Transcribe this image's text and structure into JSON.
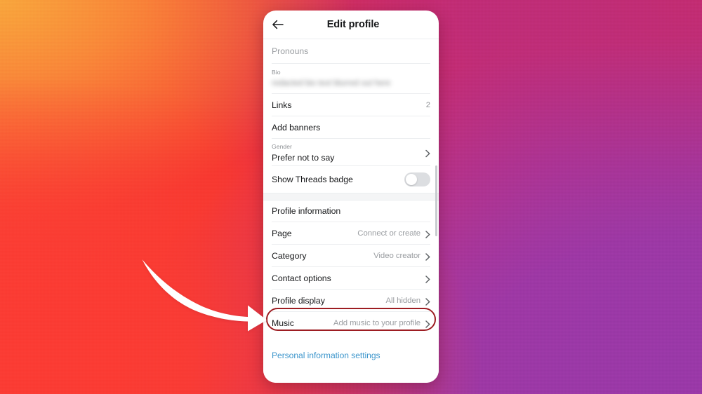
{
  "background": {
    "name": "instagram-gradient",
    "colors": {
      "orange": "#f9a63c",
      "red": "#fb3b33",
      "crimson": "#d92a5e",
      "magenta": "#b9358f",
      "purple": "#9d3aa6"
    }
  },
  "annotation": {
    "arrow_name": "curved-arrow-pointing-to-music",
    "arrow_color": "#ffffff",
    "highlight_color": "#9d1d22",
    "highlight_target": "Music"
  },
  "phone": {
    "header": {
      "back_icon": "back-arrow-icon",
      "title": "Edit profile"
    },
    "rows": [
      {
        "id": "pronouns",
        "label": "Pronouns",
        "is_placeholder": true,
        "value": "",
        "chevron": false
      },
      {
        "id": "bio",
        "caption": "Bio",
        "value": "redacted bio text blurred out here",
        "blurred": true
      },
      {
        "id": "links",
        "label": "Links",
        "count": "2",
        "chevron": false
      },
      {
        "id": "add-banners",
        "label": "Add banners",
        "value": "",
        "chevron": false
      },
      {
        "id": "gender",
        "caption": "Gender",
        "value": "Prefer not to say",
        "chevron": true
      },
      {
        "id": "show-threads-badge",
        "label": "Show Threads badge",
        "toggle": "off"
      },
      {
        "id": "profile-information",
        "label": "Profile information",
        "value": "",
        "chevron": false
      },
      {
        "id": "page",
        "label": "Page",
        "value": "Connect or create",
        "chevron": true
      },
      {
        "id": "category",
        "label": "Category",
        "value": "Video creator",
        "chevron": true
      },
      {
        "id": "contact-options",
        "label": "Contact options",
        "value": "",
        "chevron": true
      },
      {
        "id": "profile-display",
        "label": "Profile display",
        "value": "All hidden",
        "chevron": true
      },
      {
        "id": "music",
        "label": "Music",
        "value": "Add music to your profile",
        "chevron": true,
        "highlighted": true
      }
    ],
    "link": {
      "label": "Personal information settings",
      "color": "#3d96cc"
    },
    "scrollbar": {
      "name": "vertical-scrollbar",
      "color": "#c9ccd0"
    }
  }
}
